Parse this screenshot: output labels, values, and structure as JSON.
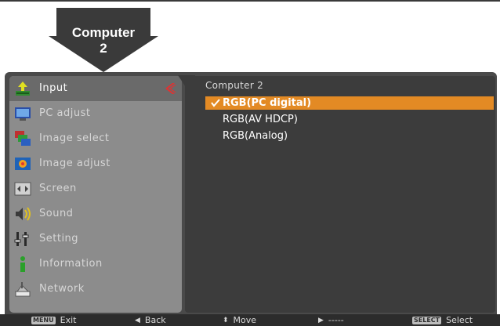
{
  "header": {
    "arrow_label_line1": "Computer",
    "arrow_label_line2": "2"
  },
  "menu": {
    "items": [
      {
        "label": "Input",
        "icon": "input-icon",
        "active": true
      },
      {
        "label": "PC adjust",
        "icon": "monitor-icon"
      },
      {
        "label": "Image select",
        "icon": "image-select-icon"
      },
      {
        "label": "Image adjust",
        "icon": "image-adjust-icon"
      },
      {
        "label": "Screen",
        "icon": "screen-icon"
      },
      {
        "label": "Sound",
        "icon": "speaker-icon"
      },
      {
        "label": "Setting",
        "icon": "setting-icon"
      },
      {
        "label": "Information",
        "icon": "info-icon"
      },
      {
        "label": "Network",
        "icon": "network-icon"
      }
    ]
  },
  "panel": {
    "title": "Computer 2",
    "options": [
      {
        "label": "RGB(PC digital)",
        "selected": true
      },
      {
        "label": "RGB(AV HDCP)"
      },
      {
        "label": "RGB(Analog)"
      }
    ]
  },
  "footer": {
    "exit_key": "MENU",
    "exit_label": "Exit",
    "back_label": "Back",
    "move_label": "Move",
    "next_label": "-----",
    "select_key": "SELECT",
    "select_label": "Select"
  },
  "colors": {
    "accent": "#e38a24",
    "chevron": "#e53030"
  }
}
